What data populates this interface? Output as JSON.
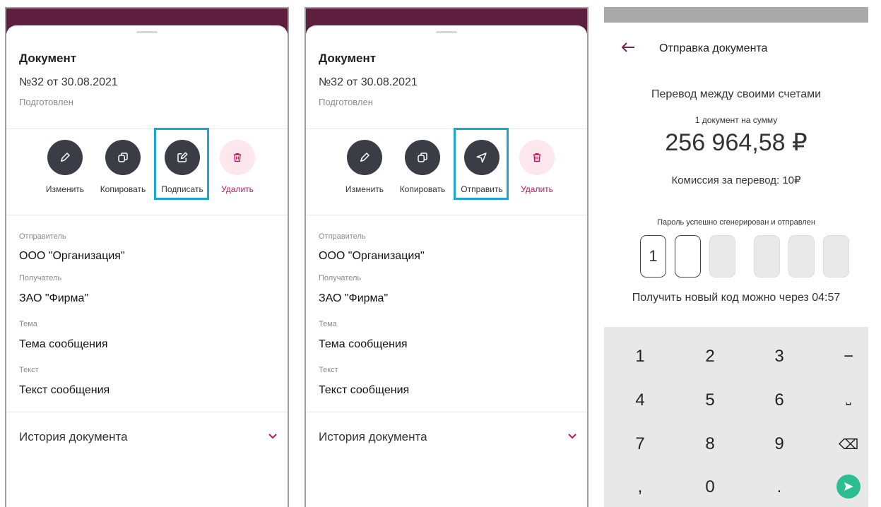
{
  "document_screen": {
    "title": "Документ",
    "number": "№32 от 30.08.2021",
    "status": "Подготовлен",
    "actions_sign": [
      "Изменить",
      "Копировать",
      "Подписать",
      "Удалить"
    ],
    "actions_send": [
      "Изменить",
      "Копировать",
      "Отправить",
      "Удалить"
    ],
    "sender_label": "Отправитель",
    "sender_value": "ООО \"Организация\"",
    "recipient_label": "Получатель",
    "recipient_value": "ЗАО \"Фирма\"",
    "subject_label": "Тема",
    "subject_value": "Тема сообщения",
    "text_label": "Текст",
    "text_value": "Текст сообщения",
    "history_label": "История документа"
  },
  "send_screen": {
    "title": "Отправка документа",
    "transfer_type": "Перевод между своими счетами",
    "doc_count": "1 документ на сумму",
    "amount": "256 964,58 ₽",
    "fee": "Комиссия за перевод: 10₽",
    "password_status": "Пароль успешно сгенерирован и отправлен",
    "code_digits": [
      "1",
      "",
      "",
      "",
      "",
      ""
    ],
    "resend_text": "Получить новый код можно через 04:57",
    "keys": {
      "row1": [
        "1",
        "2",
        "3",
        "−"
      ],
      "row2": [
        "4",
        "5",
        "6",
        "⎵"
      ],
      "row3": [
        "7",
        "8",
        "9",
        "⌫"
      ],
      "row4": [
        ",",
        "0",
        "."
      ]
    }
  },
  "colors": {
    "header_band": "#5e1f3f",
    "action_circle": "#3a3d46",
    "danger": "#c2185b",
    "highlight": "#1ea3d6",
    "send_key": "#2bbf8f"
  },
  "icons": [
    "pencil-icon",
    "copy-icon",
    "sign-icon",
    "send-icon",
    "trash-icon",
    "chevron-down-icon",
    "back-arrow-icon"
  ]
}
